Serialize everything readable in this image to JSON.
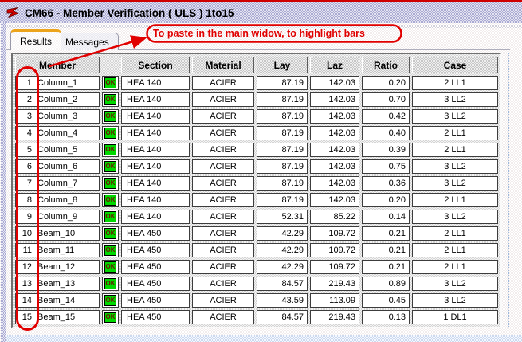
{
  "window": {
    "title": "CM66 - Member Verification ( ULS ) 1to15",
    "icon": "robot-app-icon"
  },
  "tabs": [
    {
      "label": "Results",
      "active": true
    },
    {
      "label": "Messages",
      "active": false
    }
  ],
  "annotation": {
    "text": "To paste in the main widow, to highlight bars",
    "color": "#e10000"
  },
  "table": {
    "columns": [
      "Member",
      "Section",
      "Material",
      "Lay",
      "Laz",
      "Ratio",
      "Case"
    ],
    "rows": [
      {
        "num": "1",
        "name": "Column_1",
        "status": "OK",
        "section": "HEA 140",
        "material": "ACIER",
        "lay": "87.19",
        "laz": "142.03",
        "ratio": "0.20",
        "case": "2 LL1"
      },
      {
        "num": "2",
        "name": "Column_2",
        "status": "OK",
        "section": "HEA 140",
        "material": "ACIER",
        "lay": "87.19",
        "laz": "142.03",
        "ratio": "0.70",
        "case": "3 LL2"
      },
      {
        "num": "3",
        "name": "Column_3",
        "status": "OK",
        "section": "HEA 140",
        "material": "ACIER",
        "lay": "87.19",
        "laz": "142.03",
        "ratio": "0.42",
        "case": "3 LL2"
      },
      {
        "num": "4",
        "name": "Column_4",
        "status": "OK",
        "section": "HEA 140",
        "material": "ACIER",
        "lay": "87.19",
        "laz": "142.03",
        "ratio": "0.40",
        "case": "2 LL1"
      },
      {
        "num": "5",
        "name": "Column_5",
        "status": "OK",
        "section": "HEA 140",
        "material": "ACIER",
        "lay": "87.19",
        "laz": "142.03",
        "ratio": "0.39",
        "case": "2 LL1"
      },
      {
        "num": "6",
        "name": "Column_6",
        "status": "OK",
        "section": "HEA 140",
        "material": "ACIER",
        "lay": "87.19",
        "laz": "142.03",
        "ratio": "0.75",
        "case": "3 LL2"
      },
      {
        "num": "7",
        "name": "Column_7",
        "status": "OK",
        "section": "HEA 140",
        "material": "ACIER",
        "lay": "87.19",
        "laz": "142.03",
        "ratio": "0.36",
        "case": "3 LL2"
      },
      {
        "num": "8",
        "name": "Column_8",
        "status": "OK",
        "section": "HEA 140",
        "material": "ACIER",
        "lay": "87.19",
        "laz": "142.03",
        "ratio": "0.20",
        "case": "2 LL1"
      },
      {
        "num": "9",
        "name": "Column_9",
        "status": "OK",
        "section": "HEA 140",
        "material": "ACIER",
        "lay": "52.31",
        "laz": "85.22",
        "ratio": "0.14",
        "case": "3 LL2"
      },
      {
        "num": "10",
        "name": "Beam_10",
        "status": "OK",
        "section": "HEA 450",
        "material": "ACIER",
        "lay": "42.29",
        "laz": "109.72",
        "ratio": "0.21",
        "case": "2 LL1"
      },
      {
        "num": "11",
        "name": "Beam_11",
        "status": "OK",
        "section": "HEA 450",
        "material": "ACIER",
        "lay": "42.29",
        "laz": "109.72",
        "ratio": "0.21",
        "case": "2 LL1"
      },
      {
        "num": "12",
        "name": "Beam_12",
        "status": "OK",
        "section": "HEA 450",
        "material": "ACIER",
        "lay": "42.29",
        "laz": "109.72",
        "ratio": "0.21",
        "case": "2 LL1"
      },
      {
        "num": "13",
        "name": "Beam_13",
        "status": "OK",
        "section": "HEA 450",
        "material": "ACIER",
        "lay": "84.57",
        "laz": "219.43",
        "ratio": "0.89",
        "case": "3 LL2"
      },
      {
        "num": "14",
        "name": "Beam_14",
        "status": "OK",
        "section": "HEA 450",
        "material": "ACIER",
        "lay": "43.59",
        "laz": "113.09",
        "ratio": "0.45",
        "case": "3 LL2"
      },
      {
        "num": "15",
        "name": "Beam_15",
        "status": "OK",
        "section": "HEA 450",
        "material": "ACIER",
        "lay": "84.57",
        "laz": "219.43",
        "ratio": "0.13",
        "case": "1 DL1"
      }
    ]
  },
  "colors": {
    "annotation_red": "#e10000",
    "ok_green": "#00d800",
    "tab_accent_orange": "#eca41c",
    "titlebar_lavender": "#a9a9d2",
    "top_border_red": "#cf0000"
  }
}
